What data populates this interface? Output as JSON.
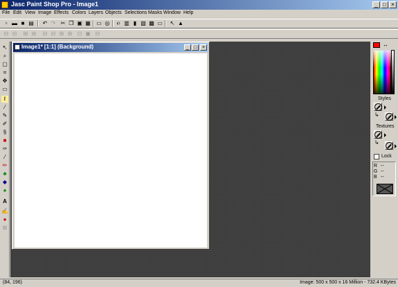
{
  "window": {
    "title": "Jasc Paint Shop Pro - Image1",
    "minimize": "_",
    "maximize": "□",
    "close": "×"
  },
  "menu": [
    "File",
    "Edit",
    "View",
    "Image",
    "Effects",
    "Colors",
    "Layers",
    "Objects",
    "Selections",
    "Masks",
    "Window",
    "Help"
  ],
  "image_window": {
    "title": "Image1* [1:1] (Background)",
    "minimize": "_",
    "maximize": "□",
    "close": "×"
  },
  "right_panel": {
    "swap_glyph": "↔",
    "styles_label": "Styles",
    "textures_label": "Textures",
    "lock_label": "Lock",
    "r_label": "R",
    "g_label": "G",
    "b_label": "B",
    "r_value": "--",
    "g_value": "--",
    "b_value": "--",
    "colors": {
      "foreground": "#ff0000",
      "background": "#ffffff"
    }
  },
  "status": {
    "cursor": "(84, 196)",
    "image_info": "Image:  500 x 500 x 16 Million - 732.4 KBytes"
  },
  "toolbar1_icons": [
    "new-icon",
    "open-icon",
    "save-icon",
    "print-icon",
    "undo-icon",
    "redo-icon",
    "cut-icon",
    "copy-icon",
    "paste-icon",
    "delete-icon",
    "browse-icon",
    "screen-capture-icon",
    "ie-icon",
    "web-icon",
    "image-icon",
    "layers-icon",
    "histogram-icon",
    "window-icon",
    "help-icon",
    "lock-icon"
  ],
  "toolbar2_icons": [
    "align-icon",
    "align-icon",
    "align-icon",
    "align-icon",
    "distribute-icon",
    "distribute-icon",
    "arrange-icon",
    "arrange-icon",
    "group-icon",
    "group-icon",
    "ungroup-icon"
  ],
  "tool_icons": [
    "arrow-icon",
    "zoom-icon",
    "deform-icon",
    "crop-icon",
    "mover-icon",
    "selection-icon",
    "freehand-icon",
    "dropper-icon",
    "paintbrush-icon",
    "clone-icon",
    "color-replacer-icon",
    "retouch-icon",
    "scratch-remover-icon",
    "eraser-icon",
    "picture-tube-icon",
    "airbrush-icon",
    "flood-fill-icon",
    "text-icon",
    "draw-icon",
    "preset-shapes-icon",
    "object-selector-icon"
  ]
}
